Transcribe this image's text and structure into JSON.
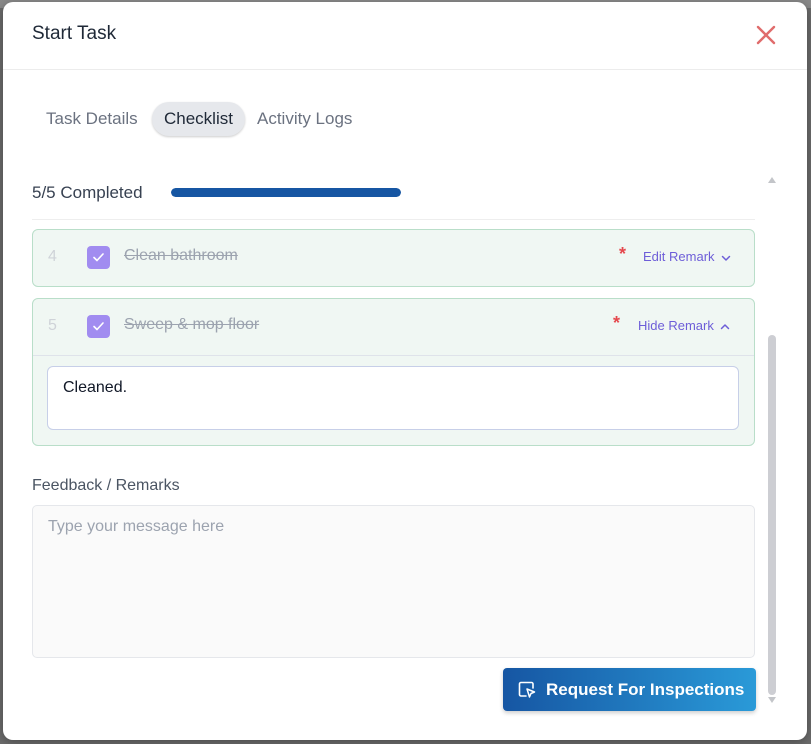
{
  "modal": {
    "title": "Start Task"
  },
  "tabs": [
    {
      "label": "Task Details",
      "active": false
    },
    {
      "label": "Checklist",
      "active": true
    },
    {
      "label": "Activity Logs",
      "active": false
    }
  ],
  "progress": {
    "label": "5/5 Completed",
    "completed": 5,
    "total": 5,
    "fraction": 1.0
  },
  "checklist": [
    {
      "number": "4",
      "text": "Clean bathroom",
      "checked": true,
      "required": "*",
      "toggle_label": "Edit Remark",
      "expanded": false
    },
    {
      "number": "5",
      "text": "Sweep & mop floor",
      "checked": true,
      "required": "*",
      "toggle_label": "Hide Remark",
      "expanded": true,
      "remark": "Cleaned."
    }
  ],
  "feedback": {
    "label": "Feedback / Remarks",
    "placeholder": "Type your message here"
  },
  "submit": {
    "label": "Request For Inspections"
  },
  "colors": {
    "accent": "#1656a3",
    "checkbox": "#a18cf0",
    "required": "#e5484d",
    "close": "#e06c6c",
    "link": "#6d5ed8"
  },
  "icons": {
    "close": "close-icon",
    "check": "check-icon",
    "chevron_down": "chevron-down-icon",
    "chevron_up": "chevron-up-icon",
    "inspect": "cursor-select-icon"
  }
}
